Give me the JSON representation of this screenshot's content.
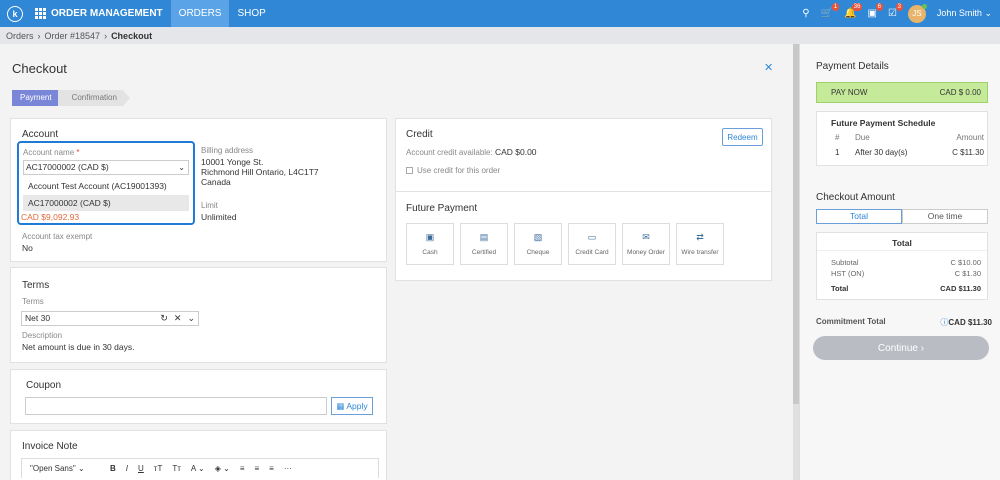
{
  "topbar": {
    "logo": "k",
    "brand": "ORDER MANAGEMENT",
    "tabs": [
      {
        "label": "ORDERS"
      },
      {
        "label": "SHOP"
      }
    ],
    "badges": {
      "cart": "1",
      "bell": "36",
      "orders": "6",
      "tasks": "3"
    },
    "avatar_initials": "JS",
    "user_name": "John Smith"
  },
  "breadcrumb": {
    "items": [
      "Orders",
      "Order #18547"
    ],
    "current": "Checkout",
    "sep": "›"
  },
  "page": {
    "title": "Checkout"
  },
  "steps": [
    {
      "label": "Payment"
    },
    {
      "label": "Confirmation"
    }
  ],
  "account": {
    "title": "Account",
    "name_label": "Account name",
    "required_mark": "*",
    "selected": "AC17000002 (CAD $)",
    "options": [
      "Account Test Account (AC19001393)",
      "AC17000002 (CAD $)"
    ],
    "balance": "CAD $9,092.93",
    "billing_label": "Billing address",
    "billing_lines": [
      "10001 Yonge St.",
      "Richmond Hill Ontario, L4C1T7",
      "Canada"
    ],
    "limit_label": "Limit",
    "limit_value": "Unlimited",
    "tax_label": "Account tax exempt",
    "tax_value": "No"
  },
  "terms": {
    "title": "Terms",
    "terms_label": "Terms",
    "terms_value": "Net 30",
    "desc_label": "Description",
    "desc_value": "Net amount is due in 30 days."
  },
  "coupon": {
    "title": "Coupon",
    "apply_label": "Apply"
  },
  "invoice_note": {
    "title": "Invoice Note",
    "font": "\"Open Sans\"",
    "tools": [
      "B",
      "I",
      "U",
      "ᴛT",
      "Tт",
      "A ⌄",
      "◈ ⌄",
      "≡",
      "≡",
      "≡",
      "···"
    ]
  },
  "credit": {
    "title": "Credit",
    "available_label": "Account credit available:",
    "available_value": "CAD $0.00",
    "use_label": "Use credit for this order",
    "redeem_label": "Redeem"
  },
  "future_payment": {
    "title": "Future Payment",
    "methods": [
      {
        "label": "Cash",
        "icon": "▣"
      },
      {
        "label": "Certified",
        "icon": "▤"
      },
      {
        "label": "Cheque",
        "icon": "▧"
      },
      {
        "label": "Credit Card",
        "icon": "▭"
      },
      {
        "label": "Money Order",
        "icon": "✉"
      },
      {
        "label": "Wire transfer",
        "icon": "⇄"
      }
    ]
  },
  "payment_details": {
    "title": "Payment Details",
    "pay_now_label": "PAY NOW",
    "pay_now_value": "CAD $ 0.00",
    "schedule_title": "Future Payment Schedule",
    "cols": [
      "#",
      "Due",
      "Amount"
    ],
    "rows": [
      {
        "num": "1",
        "due": "After 30 day(s)",
        "amount": "C $11.30"
      }
    ]
  },
  "checkout_amount": {
    "title": "Checkout Amount",
    "toggle": [
      "Total",
      "One time"
    ],
    "card_title": "Total",
    "subtotal_label": "Subtotal",
    "subtotal_value": "C $10.00",
    "hst_label": "HST (ON)",
    "hst_value": "C $1.30",
    "total_label": "Total",
    "total_value": "CAD $11.30"
  },
  "commitment": {
    "label": "Commitment Total",
    "value": "CAD $11.30",
    "info_icon": "ⓘ"
  },
  "continue_label": "Continue ›"
}
